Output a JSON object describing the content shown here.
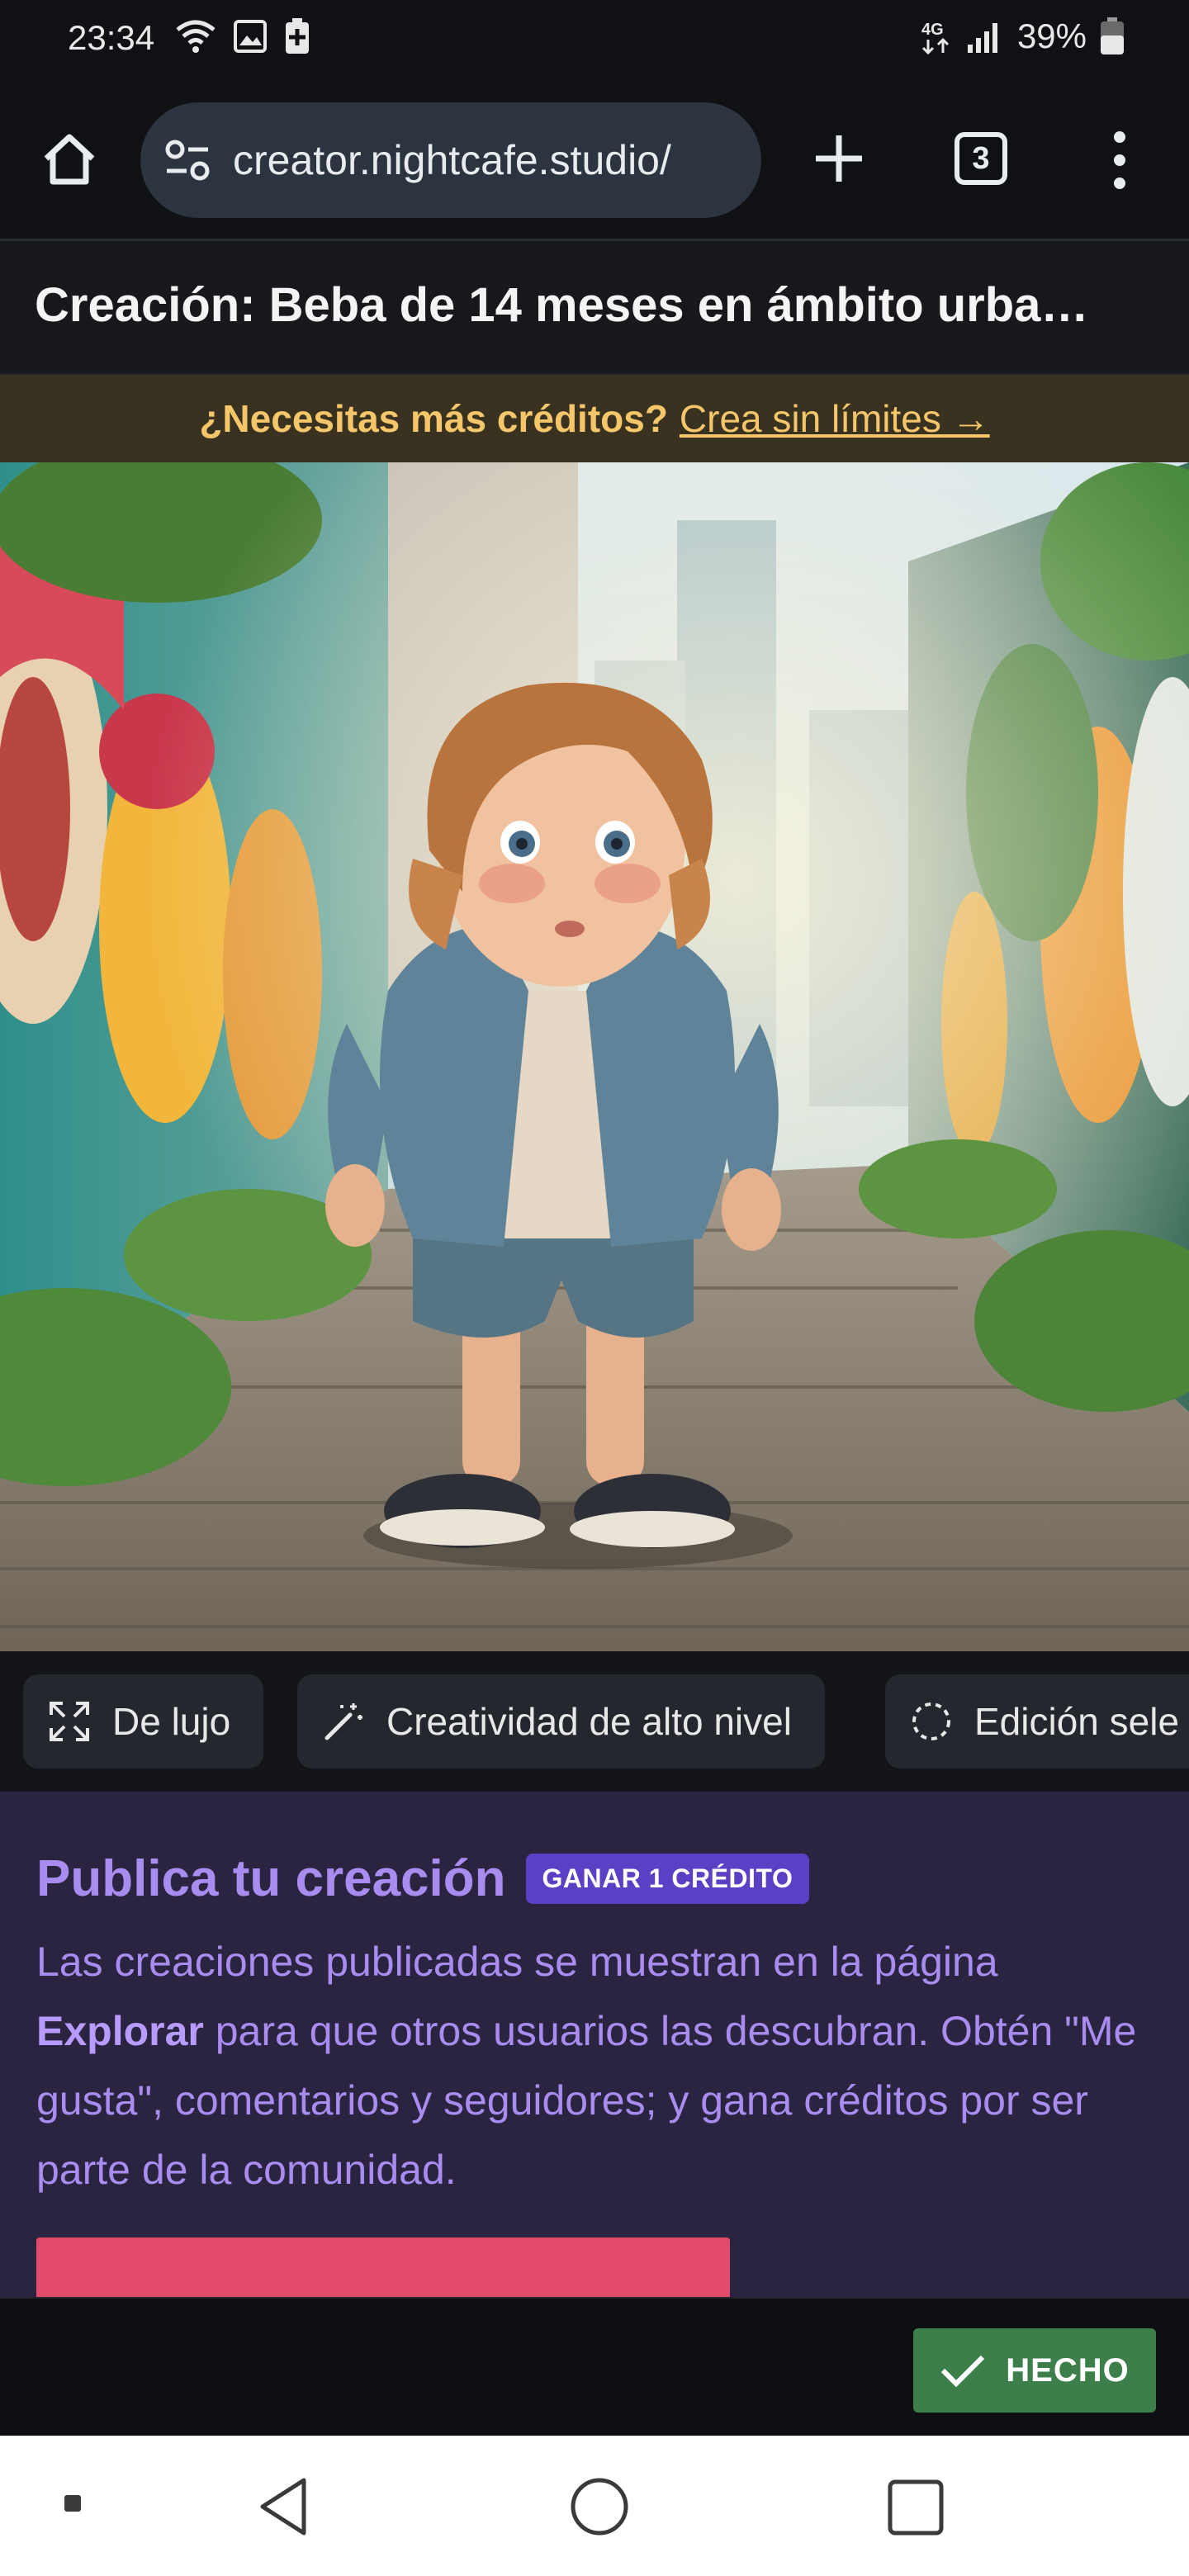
{
  "status_bar": {
    "time": "23:34",
    "battery_percent": "39%",
    "icons": [
      "wifi-icon",
      "gallery-icon",
      "battery-saver-icon",
      "4g-icon",
      "signal-icon",
      "battery-icon"
    ]
  },
  "browser": {
    "url": "creator.nightcafe.studio/",
    "tab_count": "3",
    "icons": [
      "home-icon",
      "site-settings-icon",
      "new-tab-plus-icon",
      "tab-switcher-icon",
      "more-vert-icon"
    ]
  },
  "page": {
    "title": "Creación: Beba de 14 meses en ámbito urba…"
  },
  "credit_banner": {
    "question": "¿Necesitas más créditos?",
    "link": "Crea sin límites →"
  },
  "chips": [
    {
      "label": "De lujo",
      "icon": "expand-icon"
    },
    {
      "label": "Creatividad de alto nivel",
      "icon": "magic-wand-icon"
    },
    {
      "label": "Edición sele",
      "icon": "dashed-circle-icon"
    }
  ],
  "publish": {
    "title": "Publica tu creación",
    "badge": "GANAR 1 CRÉDITO",
    "body_1": "Las creaciones publicadas se muestran en la página ",
    "body_bold": "Explorar",
    "body_2": " para que otros usuarios las descubran. Obtén \"Me gusta\", comentarios y seguidores; y gana créditos por ser parte de la comunidad."
  },
  "action_bar": {
    "done_label": "HECHO"
  },
  "colors": {
    "accent_purple": "#a98cf0",
    "badge_purple": "#5b3fc4",
    "banner_gold": "#f6c66a",
    "done_green": "#3d7f4a",
    "publish_pink": "#e34b6a"
  }
}
